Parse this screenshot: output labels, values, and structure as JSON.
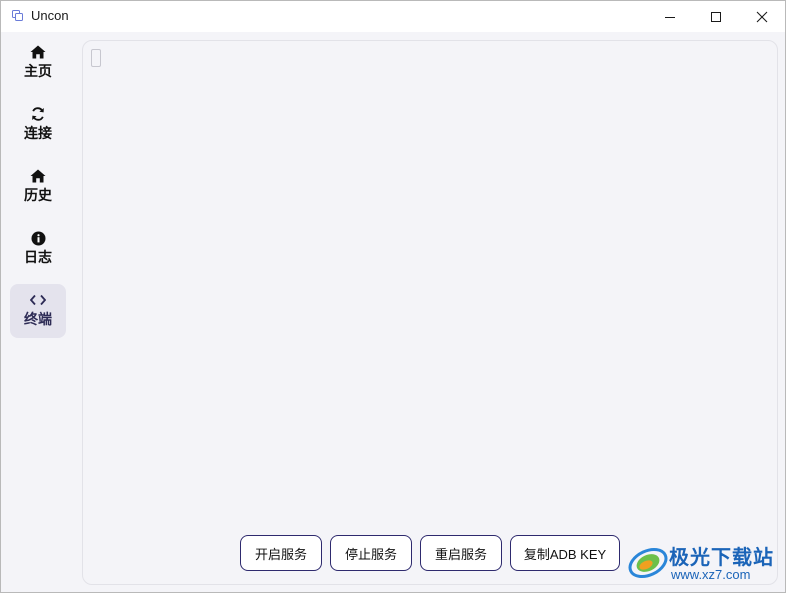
{
  "window": {
    "title": "Uncon"
  },
  "sidebar": {
    "items": [
      {
        "label": "主页",
        "icon": "home-icon"
      },
      {
        "label": "连接",
        "icon": "sync-icon"
      },
      {
        "label": "历史",
        "icon": "home-icon"
      },
      {
        "label": "日志",
        "icon": "info-icon"
      },
      {
        "label": "终端",
        "icon": "code-icon",
        "active": true
      }
    ]
  },
  "terminal": {
    "buttons": [
      {
        "label": "开启服务"
      },
      {
        "label": "停止服务"
      },
      {
        "label": "重启服务"
      },
      {
        "label": "复制ADB KEY"
      }
    ]
  },
  "watermark": {
    "name": "极光下载站",
    "url": "www.xz7.com"
  },
  "colors": {
    "accent": "#2e2a6e",
    "active_bg": "#e4e3ed",
    "watermark": "#1b64b8"
  }
}
